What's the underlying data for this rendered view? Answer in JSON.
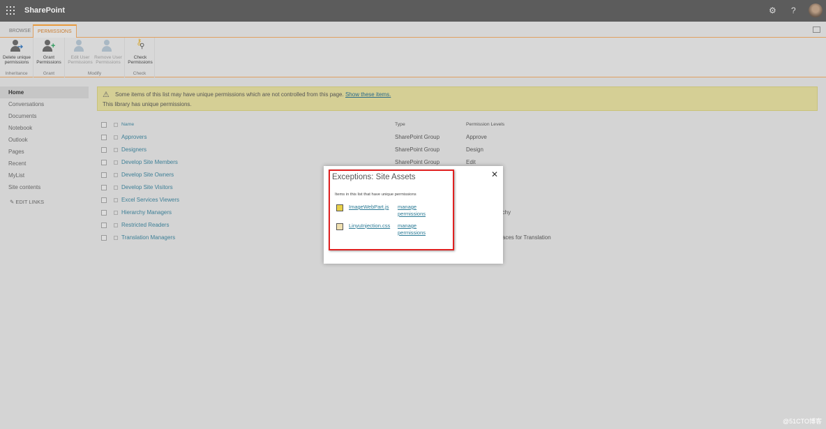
{
  "app": {
    "title": "SharePoint",
    "icons": [
      "waffle-icon",
      "gear-icon",
      "help-icon",
      "avatar"
    ]
  },
  "tabs": [
    {
      "label": "BROWSE",
      "active": false
    },
    {
      "label": "PERMISSIONS",
      "active": true
    }
  ],
  "ribbon": {
    "groups": [
      {
        "label": "Inheritance",
        "buttons": [
          {
            "label": "Delete unique permissions",
            "enabled": true
          }
        ]
      },
      {
        "label": "Grant",
        "buttons": [
          {
            "label": "Grant Permissions",
            "enabled": true
          }
        ]
      },
      {
        "label": "Modify",
        "buttons": [
          {
            "label": "Edit User Permissions",
            "enabled": false
          },
          {
            "label": "Remove User Permissions",
            "enabled": false
          }
        ]
      },
      {
        "label": "Check",
        "buttons": [
          {
            "label": "Check Permissions",
            "enabled": true
          }
        ]
      }
    ]
  },
  "nav": {
    "items": [
      "Home",
      "Conversations",
      "Documents",
      "Notebook",
      "Outlook",
      "Pages",
      "Recent",
      "MyList",
      "Site contents"
    ],
    "selected": "Home",
    "edit_links": "EDIT LINKS"
  },
  "banner": {
    "line1": "Some items of this list may have unique permissions which are not controlled from this page.",
    "link": "Show these items.",
    "line2": "This library has unique permissions."
  },
  "table": {
    "headers": {
      "name": "Name",
      "type": "Type",
      "level": "Permission Levels"
    },
    "rows": [
      {
        "name": "Approvers",
        "type": "SharePoint Group",
        "level": "Approve"
      },
      {
        "name": "Designers",
        "type": "SharePoint Group",
        "level": "Design"
      },
      {
        "name": "Develop Site Members",
        "type": "SharePoint Group",
        "level": "Edit"
      },
      {
        "name": "Develop Site Owners",
        "type": "",
        "level": ""
      },
      {
        "name": "Develop Site Visitors",
        "type": "",
        "level": ""
      },
      {
        "name": "Excel Services Viewers",
        "type": "",
        "level": ""
      },
      {
        "name": "Hierarchy Managers",
        "type": "",
        "level": "rchy"
      },
      {
        "name": "Restricted Readers",
        "type": "",
        "level": "d"
      },
      {
        "name": "Translation Managers",
        "type": "",
        "level": "rfaces for Translation"
      }
    ]
  },
  "dialog": {
    "title": "Exceptions: Site Assets",
    "subtitle": "Items in this list that have unique permissions",
    "items": [
      {
        "file": "ImageWebPart.js",
        "action": "manage permissions"
      },
      {
        "file": "LinyuInjection.css",
        "action": "manage permissions"
      }
    ]
  },
  "watermark": "@51CTO博客"
}
